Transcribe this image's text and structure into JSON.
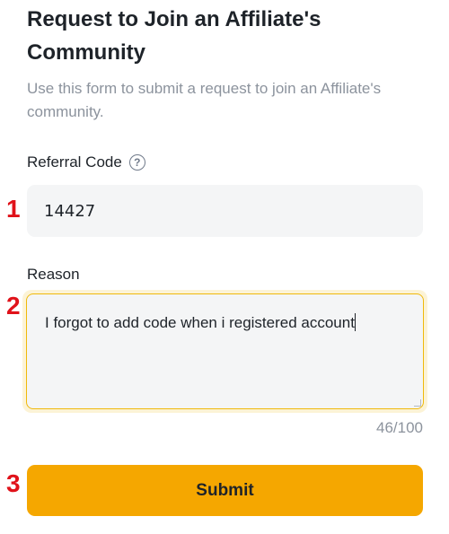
{
  "form": {
    "title": "Request to Join an Affiliate's Community",
    "subtitle": "Use this form to submit a request to join an Affiliate's community.",
    "referral": {
      "label": "Referral Code",
      "help_icon": "question-circle-icon",
      "value": "14427"
    },
    "reason": {
      "label": "Reason",
      "value": "I forgot to add code when i registered account",
      "char_count": "46/100"
    },
    "submit_label": "Submit"
  },
  "markers": {
    "step1": "1",
    "step2": "2",
    "step3": "3"
  },
  "colors": {
    "accent": "#f5a700",
    "focus_border": "#f0b90b",
    "marker": "#e0121a",
    "input_bg": "#f4f5f6",
    "muted_text": "#8c939d"
  }
}
